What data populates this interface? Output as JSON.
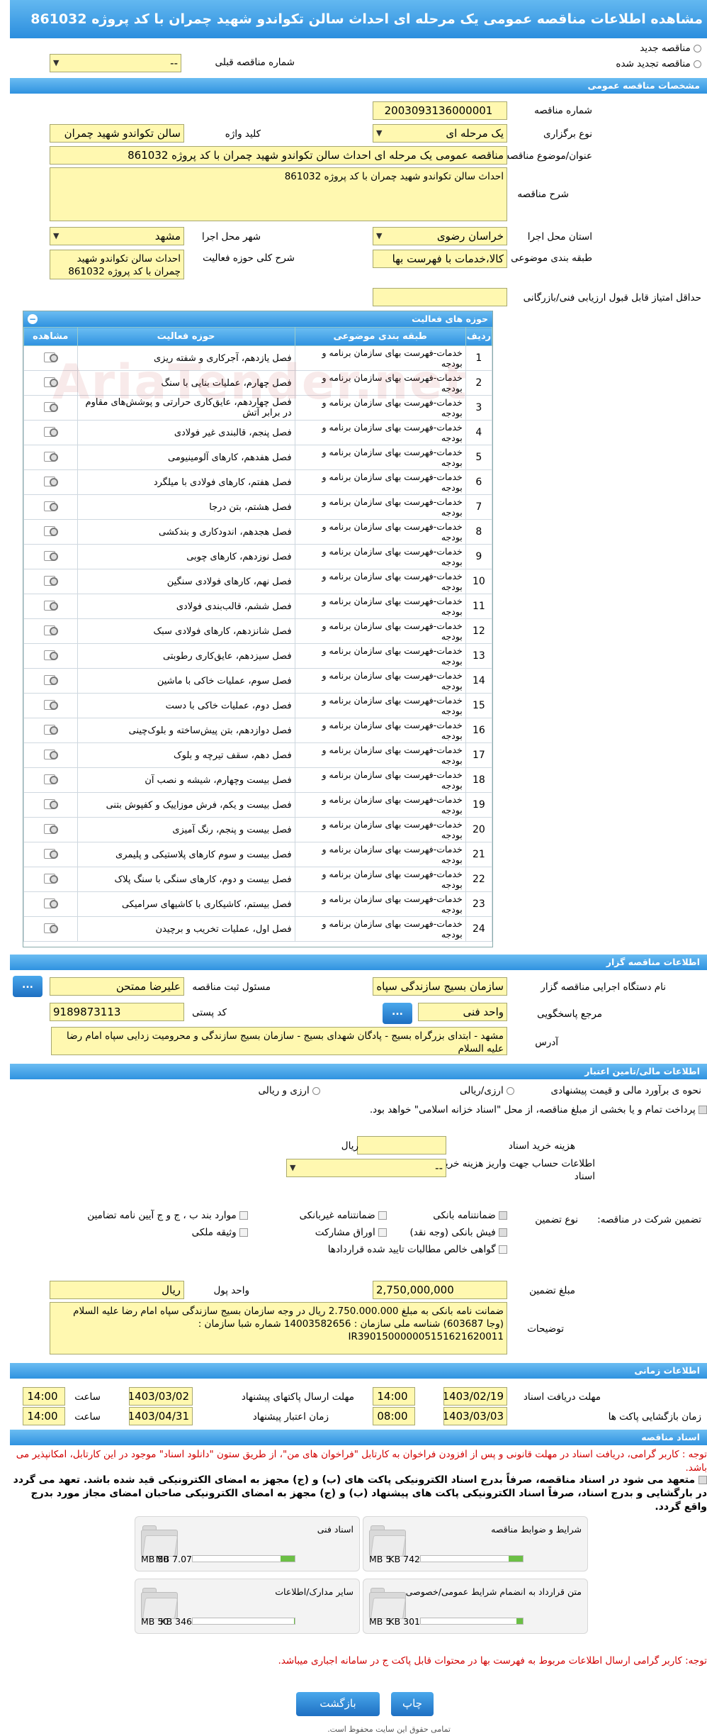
{
  "title": "مشاهده اطلاعات مناقصه عمومی یک مرحله ای احداث سالن تکواندو شهید چمران با کد پروژه 861032",
  "top": {
    "new_label": "مناقصه جدید",
    "renewed_label": "مناقصه تجدید شده",
    "prev_label": "شماره مناقصه قبلی",
    "prev_value": "--"
  },
  "sections": {
    "general": "مشخصات مناقصه عمومی",
    "activity": "حوزه های فعالیت",
    "organizer": "اطلاعات مناقصه گزار",
    "finance": "اطلاعات مالی/تامین اعتبار",
    "timing": "اطلاعات زمانی",
    "docs": "اسناد مناقصه"
  },
  "general": {
    "number_label": "شماره مناقصه",
    "number": "2003093136000001",
    "type_label": "نوع برگزاری",
    "type": "یک مرحله ای",
    "keyword_label": "کلید واژه",
    "keyword": "سالن تکواندو شهید چمران",
    "subject_label": "عنوان/موضوع مناقصه",
    "subject": "مناقصه عمومی یک مرحله ای احداث سالن تکواندو شهید چمران با کد پروژه 861032",
    "desc_label": "شرح مناقصه",
    "desc": "احداث سالن تکواندو شهید چمران با کد پروژه 861032",
    "province_label": "استان محل اجرا",
    "province": "خراسان رضوی",
    "city_label": "شهر محل اجرا",
    "city": "مشهد",
    "category_label": "طبقه بندی موضوعی",
    "category": "کالا،خدمات با فهرست بها",
    "scope_label": "شرح کلی حوزه فعالیت",
    "scope": "احداث سالن تکواندو شهید چمران با کد پروژه 861032",
    "min_score_label": "حداقل امتیاز قابل قبول ارزیابی فنی/بازرگانی",
    "min_score": ""
  },
  "activity_table": {
    "headers": {
      "row": "ردیف",
      "category": "طبقه بندی موضوعی",
      "area": "حوزه فعالیت",
      "view": "مشاهده"
    },
    "rows": [
      {
        "n": "1",
        "c": "خدمات-فهرست بهای سازمان برنامه و بودجه",
        "a": "فصل یازدهم، آجرکاری و شفته ریزی"
      },
      {
        "n": "2",
        "c": "خدمات-فهرست بهای سازمان برنامه و بودجه",
        "a": "فصل چهارم، عملیات بنایی با سنگ"
      },
      {
        "n": "3",
        "c": "خدمات-فهرست بهای سازمان برنامه و بودجه",
        "a": "فصل چهاردهم، عایق‌کاری حرارتی و پوشش‌های مقاوم در برابر آتش"
      },
      {
        "n": "4",
        "c": "خدمات-فهرست بهای سازمان برنامه و بودجه",
        "a": "فصل پنجم، قالبندی غیر فولادی"
      },
      {
        "n": "5",
        "c": "خدمات-فهرست بهای سازمان برنامه و بودجه",
        "a": "فصل هفدهم، کارهای آلومینیومی"
      },
      {
        "n": "6",
        "c": "خدمات-فهرست بهای سازمان برنامه و بودجه",
        "a": "فصل هفتم، کارهای فولادی با میلگرد"
      },
      {
        "n": "7",
        "c": "خدمات-فهرست بهای سازمان برنامه و بودجه",
        "a": "فصل هشتم، بتن درجا"
      },
      {
        "n": "8",
        "c": "خدمات-فهرست بهای سازمان برنامه و بودجه",
        "a": "فصل هجدهم، اندودکاری و بندکشی"
      },
      {
        "n": "9",
        "c": "خدمات-فهرست بهای سازمان برنامه و بودجه",
        "a": "فصل نوزدهم، کارهای چوبی"
      },
      {
        "n": "10",
        "c": "خدمات-فهرست بهای سازمان برنامه و بودجه",
        "a": "فصل نهم، کارهای فولادی سنگین"
      },
      {
        "n": "11",
        "c": "خدمات-فهرست بهای سازمان برنامه و بودجه",
        "a": "فصل ششم، قالب‌بندی فولادی"
      },
      {
        "n": "12",
        "c": "خدمات-فهرست بهای سازمان برنامه و بودجه",
        "a": "فصل شانزدهم، کارهای فولادی سبک"
      },
      {
        "n": "13",
        "c": "خدمات-فهرست بهای سازمان برنامه و بودجه",
        "a": "فصل سیزدهم، عایق‌کاری رطوبتی"
      },
      {
        "n": "14",
        "c": "خدمات-فهرست بهای سازمان برنامه و بودجه",
        "a": "فصل سوم، عملیات خاکی با ماشین"
      },
      {
        "n": "15",
        "c": "خدمات-فهرست بهای سازمان برنامه و بودجه",
        "a": "فصل دوم، عملیات خاکی با دست"
      },
      {
        "n": "16",
        "c": "خدمات-فهرست بهای سازمان برنامه و بودجه",
        "a": "فصل دوازدهم، بتن پیش‌ساخته و بلوک‌چینی"
      },
      {
        "n": "17",
        "c": "خدمات-فهرست بهای سازمان برنامه و بودجه",
        "a": "فصل دهم، سقف تیرچه و بلوک"
      },
      {
        "n": "18",
        "c": "خدمات-فهرست بهای سازمان برنامه و بودجه",
        "a": "فصل بیست وچهارم، شیشه و نصب آن"
      },
      {
        "n": "19",
        "c": "خدمات-فهرست بهای سازمان برنامه و بودجه",
        "a": "فصل بیست و یکم، فرش موزاییک و کفپوش بتنی"
      },
      {
        "n": "20",
        "c": "خدمات-فهرست بهای سازمان برنامه و بودجه",
        "a": "فصل بیست و پنجم، رنگ آمیزی"
      },
      {
        "n": "21",
        "c": "خدمات-فهرست بهای سازمان برنامه و بودجه",
        "a": "فصل بیست و سوم کارهای پلاستیکی و پلیمری"
      },
      {
        "n": "22",
        "c": "خدمات-فهرست بهای سازمان برنامه و بودجه",
        "a": "فصل بیست و دوم، کارهای سنگی با سنگ پلاک"
      },
      {
        "n": "23",
        "c": "خدمات-فهرست بهای سازمان برنامه و بودجه",
        "a": "فصل بیستم، کاشیکاری با کاشیهای سرامیکی"
      },
      {
        "n": "24",
        "c": "خدمات-فهرست بهای سازمان برنامه و بودجه",
        "a": "فصل اول، عملیات تخریب و برچیدن"
      }
    ]
  },
  "organizer": {
    "org_label": "نام دستگاه اجرایی مناقصه گزار",
    "org": "سازمان بسیج سازندگی سپاه",
    "resp_label": "مسئول ثبت مناقصه",
    "resp": "علیرضا ممتحن",
    "ref_label": "مرجع پاسخگویی",
    "ref": "واحد فنی",
    "postal_label": "کد پستی",
    "postal": "9189873113",
    "addr_label": "آدرس",
    "addr": "مشهد - ابتدای بزرگراه بسیج - پادگان شهدای بسیج - سازمان بسیج سازندگی و محرومیت زدایی سپاه امام رضا علیه السلام",
    "dots": "..."
  },
  "finance": {
    "estimate_label": "نحوه ی برآورد مالی و قیمت پیشنهادی",
    "opt1": "ارزی/ریالی",
    "opt2": "ارزی و ریالی",
    "treasury_text": "پرداخت تمام و یا بخشی از مبلغ مناقصه، از محل \"اسناد خزانه اسلامی\" خواهد بود.",
    "doc_fee_label": "هزینه خرید اسناد",
    "doc_fee": "",
    "rial": "ریال",
    "account_label": "اطلاعات حساب جهت واریز هزینه خرید اسناد",
    "account": "--",
    "guarantee_label": "نوع تضمین",
    "participation_label": "تضمین شرکت در مناقصه:",
    "g1": "ضمانتنامه بانکی",
    "g2": "ضمانتنامه غیربانکی",
    "g3": "موارد بند ب ، ج و ج آیین نامه تضامین",
    "g4": "فیش بانکی (وجه نقد)",
    "g5": "اوراق مشارکت",
    "g6": "وثیقه ملکی",
    "g7": "گواهی خالص مطالبات تایید شده قراردادها",
    "amount_label": "مبلغ تضمین",
    "amount": "2,750,000,000",
    "currency_label": "واحد پول",
    "currency": "ریال",
    "notes_label": "توضیحات",
    "notes": "ضمانت نامه بانکی به مبلغ 2.750.000.000 ریال در وجه سازمان بسیج سازندگی سپاه امام رضا علیه السلام (وجا 603687) شناسه ملی سازمان : 14003582656 شماره شبا سازمان : IR390150000005151621620011"
  },
  "timing": {
    "recv_label": "مهلت دریافت اسناد",
    "recv_date": "1403/02/19",
    "recv_time": "14:00",
    "send_label": "مهلت ارسال پاکتهای پیشنهاد",
    "send_date": "1403/03/02",
    "send_time": "14:00",
    "open_label": "زمان بازگشایی پاکت ها",
    "open_date": "1403/03/03",
    "open_time": "08:00",
    "valid_label": "زمان اعتبار پیشنهاد",
    "valid_date": "1403/04/31",
    "valid_time": "14:00",
    "time_label": "ساعت"
  },
  "docs": {
    "note1": "توجه : کاربر گرامی، دریافت اسناد در مهلت قانونی و پس از افزودن فراخوان به کارتابل \"فراخوان های من\"، از طریق ستون \"دانلود اسناد\" موجود در این کارتابل، امکانپذیر می باشد.",
    "note2": "متعهد می شود در اسناد مناقصه، صرفاً بدرج اسناد الکترونیکی پاکت های (ب) و (ج) مجهز به امضای الکترونیکی قید شده باشد. تعهد می گردد در بارگشایی و بدرج اسناد، صرفاً اسناد الکترونیکی پاکت های پیشنهاد (ب) و (ج) مجهز به امضای الکترونیکی صاحبان امضای مجاز مورد بدرج واقع گردد.",
    "items": [
      {
        "title": "شرایط و ضوابط مناقصه",
        "size": "742 KB",
        "max": "5 MB",
        "fill": 0.14
      },
      {
        "title": "اسناد فنی",
        "size": "7.07 MB",
        "max": "50 MB",
        "fill": 0.14
      },
      {
        "title": "متن قرارداد به انضمام شرایط عمومی/خصوصی",
        "size": "301 KB",
        "max": "5 MB",
        "fill": 0.06
      },
      {
        "title": "سایر مدارک/اطلاعات",
        "size": "346 KB",
        "max": "50 MB",
        "fill": 0.01
      }
    ],
    "note3": "توجه: کاربر گرامی ارسال اطلاعات مربوط به فهرست بها در محتوات قابل پاکت ج در سامانه اجباری میباشد."
  },
  "footer": {
    "print": "چاپ",
    "back": "بازگشت",
    "copyright": "تمامی حقوق این سایت محفوظ است."
  },
  "watermark": "AriaTender.net"
}
